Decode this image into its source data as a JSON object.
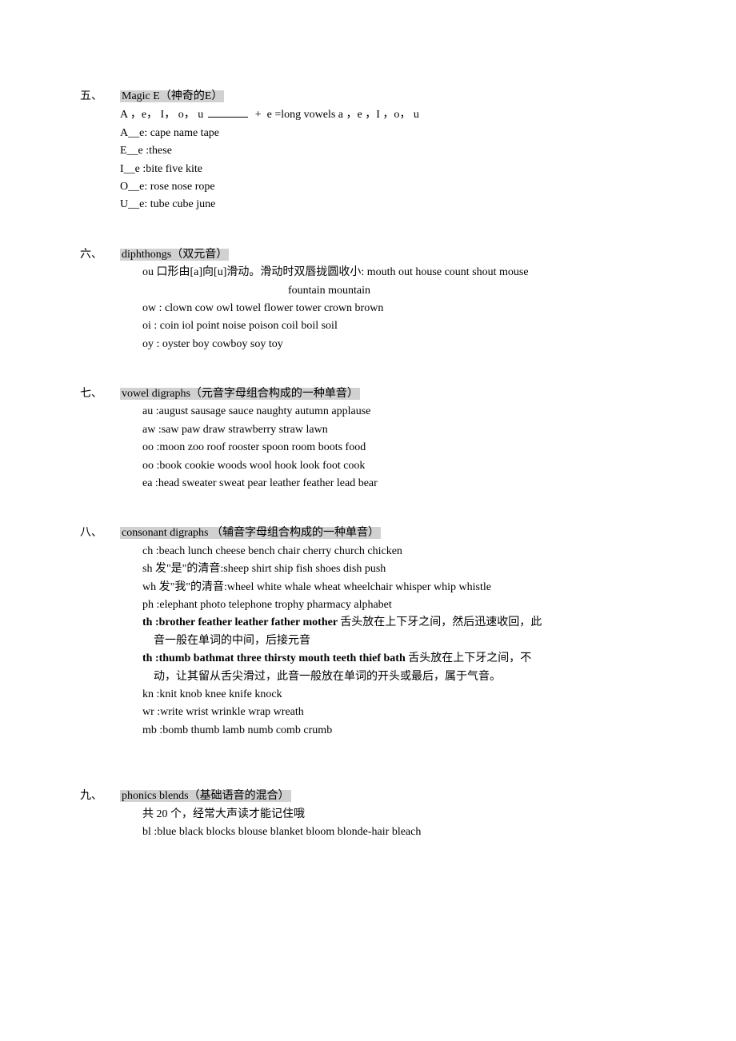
{
  "sections": [
    {
      "number": "五、",
      "title": "Magic E（神奇的E）",
      "lines": [
        {
          "text_pre": "A ，e， I， o， u ",
          "blank": true,
          "text_post": "  +  e =long vowels a ，e ，I ，o， u"
        },
        {
          "text": "A__e: cape name tape"
        },
        {
          "text": "E__e :these"
        },
        {
          "text": "I__e :bite five kite"
        },
        {
          "text": "O__e: rose nose rope"
        },
        {
          "text": "U__e: tube cube june"
        }
      ]
    },
    {
      "number": "六、",
      "title": "diphthongs（双元音）",
      "lines": [
        {
          "text": "ou 口形由[a]向[u]滑动。滑动时双唇拢圆收小: mouth out house count shout mouse",
          "indent": "indent1"
        },
        {
          "text": "fountain mountain",
          "indent": "indent2"
        },
        {
          "text": "ow : clown cow owl towel flower tower crown brown",
          "indent": "indent1"
        },
        {
          "text": "oi : coin iol point noise poison coil boil soil",
          "indent": "indent1"
        },
        {
          "text": "oy : oyster boy cowboy soy toy",
          "indent": "indent1"
        }
      ]
    },
    {
      "number": "七、",
      "title": "vowel digraphs（元音字母组合构成的一种单音）",
      "lines": [
        {
          "text": "au :august sausage sauce naughty autumn applause",
          "indent": "indent1"
        },
        {
          "text": "aw :saw paw draw strawberry straw lawn",
          "indent": "indent1"
        },
        {
          "text": "oo :moon zoo roof rooster spoon room boots food",
          "indent": "indent1"
        },
        {
          "text": "oo :book cookie woods wool hook look foot cook",
          "indent": "indent1"
        },
        {
          "text": "ea :head sweater sweat pear leather feather lead bear",
          "indent": "indent1"
        }
      ]
    },
    {
      "number": "八、",
      "title": "consonant digraphs （辅音字母组合构成的一种单音）",
      "lines": [
        {
          "text": "ch :beach lunch cheese bench chair cherry church chicken",
          "indent": "indent1"
        },
        {
          "text": "sh 发\"是\"的清音:sheep shirt ship fish shoes dish push",
          "indent": "indent1"
        },
        {
          "text": "wh 发\"我\"的清音:wheel white whale wheat wheelchair whisper whip whistle",
          "indent": "indent1"
        },
        {
          "text": "ph :elephant photo telephone trophy pharmacy alphabet",
          "indent": "indent1"
        },
        {
          "bold_text": "th :brother feather leather father mother ",
          "rest": "舌头放在上下牙之间，然后迅速收回，此",
          "indent": "indent1"
        },
        {
          "text": "音一般在单词的中间，后接元音",
          "indent": "indent-sub"
        },
        {
          "bold_text": "th :thumb bathmat three thirsty mouth teeth thief bath ",
          "rest": "舌头放在上下牙之间，不",
          "indent": "indent1"
        },
        {
          "text": "动，让其留从舌尖滑过，此音一般放在单词的开头或最后，属于气音。",
          "indent": "indent-sub"
        },
        {
          "text": "kn :knit knob knee knife knock",
          "indent": "indent1"
        },
        {
          "text": "wr :write wrist wrinkle wrap wreath",
          "indent": "indent1"
        },
        {
          "text": "mb :bomb thumb lamb numb comb crumb",
          "indent": "indent1"
        }
      ],
      "extra_space": true
    },
    {
      "number": "九、",
      "title": "phonics blends（基础语音的混合）",
      "lines": [
        {
          "text": "共 20 个，经常大声读才能记住哦",
          "indent": "indent1"
        },
        {
          "text": "bl :blue black blocks blouse blanket bloom blonde-hair bleach",
          "indent": "indent1"
        }
      ]
    }
  ]
}
